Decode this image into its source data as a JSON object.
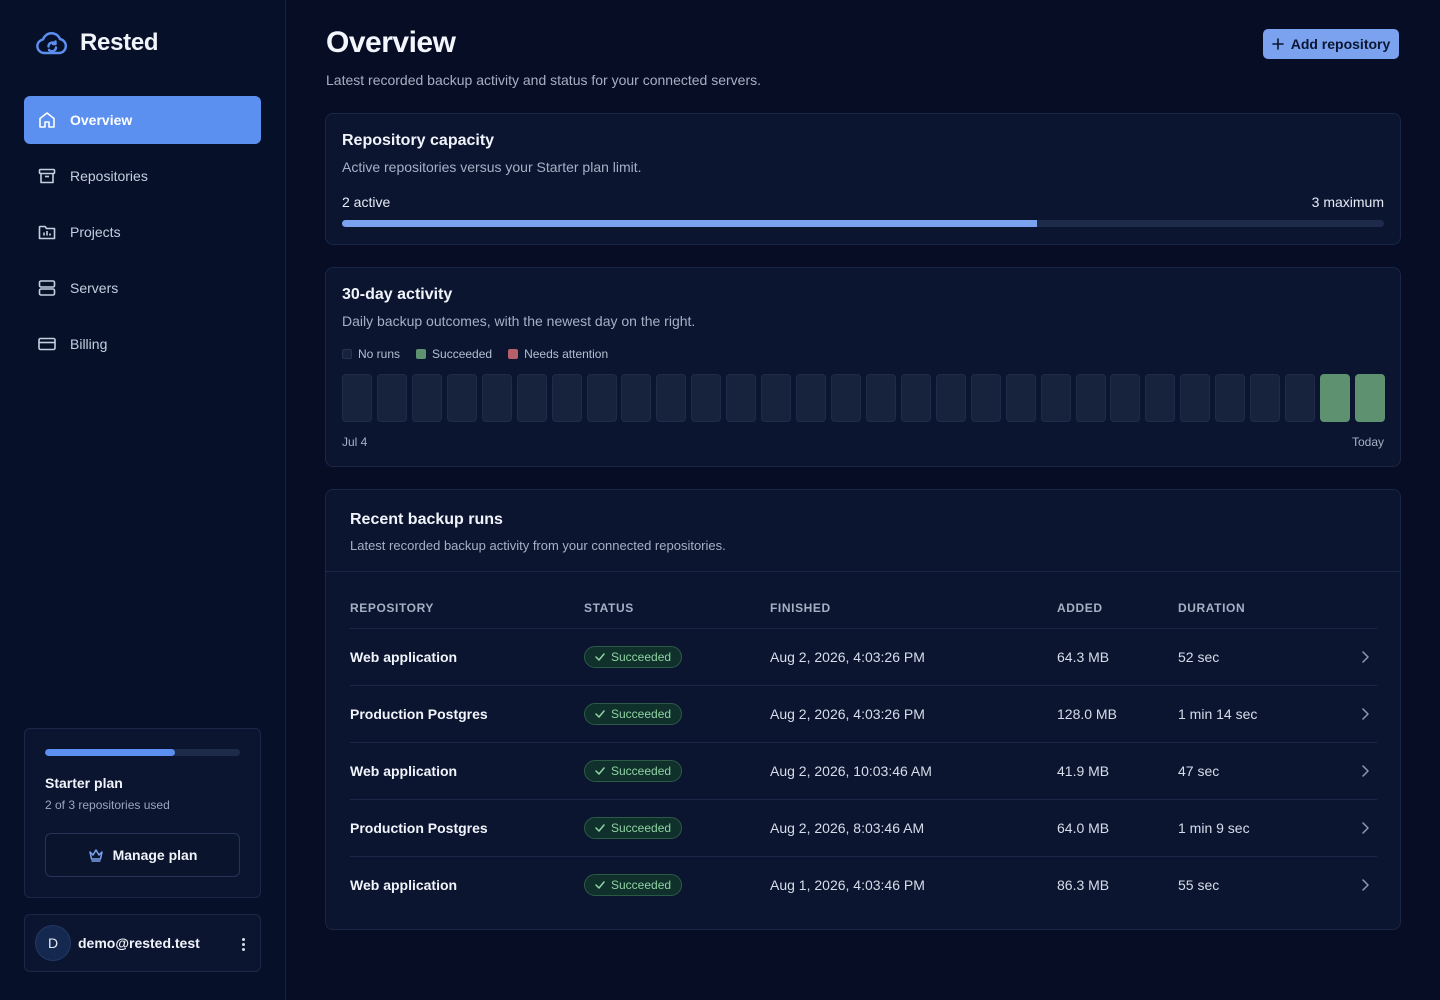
{
  "app": {
    "name": "Rested"
  },
  "sidebar": {
    "items": [
      {
        "label": "Overview",
        "icon": "home-icon",
        "active": true
      },
      {
        "label": "Repositories",
        "icon": "archive-icon",
        "active": false
      },
      {
        "label": "Projects",
        "icon": "folder-chart-icon",
        "active": false
      },
      {
        "label": "Servers",
        "icon": "server-icon",
        "active": false
      },
      {
        "label": "Billing",
        "icon": "credit-card-icon",
        "active": false
      }
    ],
    "plan": {
      "name": "Starter plan",
      "usage": "2 of 3 repositories used",
      "used_fraction": 0.667,
      "manage_label": "Manage plan"
    },
    "user": {
      "initial": "D",
      "email": "demo@rested.test"
    }
  },
  "header": {
    "title": "Overview",
    "subtitle": "Latest recorded backup activity and status for your connected servers.",
    "add_label": "Add repository"
  },
  "capacity": {
    "title": "Repository capacity",
    "description": "Active repositories versus your Starter plan limit.",
    "active_label": "2 active",
    "max_label": "3 maximum",
    "active": 2,
    "maximum": 3
  },
  "activity": {
    "title": "30-day activity",
    "description": "Daily backup outcomes, with the newest day on the right.",
    "legend": {
      "none": "No runs",
      "success": "Succeeded",
      "attention": "Needs attention"
    },
    "start_label": "Jul 4",
    "end_label": "Today",
    "days": [
      "none",
      "none",
      "none",
      "none",
      "none",
      "none",
      "none",
      "none",
      "none",
      "none",
      "none",
      "none",
      "none",
      "none",
      "none",
      "none",
      "none",
      "none",
      "none",
      "none",
      "none",
      "none",
      "none",
      "none",
      "none",
      "none",
      "none",
      "none",
      "success",
      "success"
    ]
  },
  "runs": {
    "title": "Recent backup runs",
    "description": "Latest recorded backup activity from your connected repositories.",
    "columns": {
      "repository": "REPOSITORY",
      "status": "STATUS",
      "finished": "FINISHED",
      "added": "ADDED",
      "duration": "DURATION"
    },
    "rows": [
      {
        "repository": "Web application",
        "status": "Succeeded",
        "finished": "Aug 2, 2026, 4:03:26 PM",
        "added": "64.3 MB",
        "duration": "52 sec"
      },
      {
        "repository": "Production Postgres",
        "status": "Succeeded",
        "finished": "Aug 2, 2026, 4:03:26 PM",
        "added": "128.0 MB",
        "duration": "1 min 14 sec"
      },
      {
        "repository": "Web application",
        "status": "Succeeded",
        "finished": "Aug 2, 2026, 10:03:46 AM",
        "added": "41.9 MB",
        "duration": "47 sec"
      },
      {
        "repository": "Production Postgres",
        "status": "Succeeded",
        "finished": "Aug 2, 2026, 8:03:46 AM",
        "added": "64.0 MB",
        "duration": "1 min 9 sec"
      },
      {
        "repository": "Web application",
        "status": "Succeeded",
        "finished": "Aug 1, 2026, 4:03:46 PM",
        "added": "86.3 MB",
        "duration": "55 sec"
      }
    ]
  },
  "colors": {
    "accent": "#5b8ff0",
    "day_none": "#17223d",
    "day_success": "#5e9170",
    "day_attention": "#b5606a"
  }
}
